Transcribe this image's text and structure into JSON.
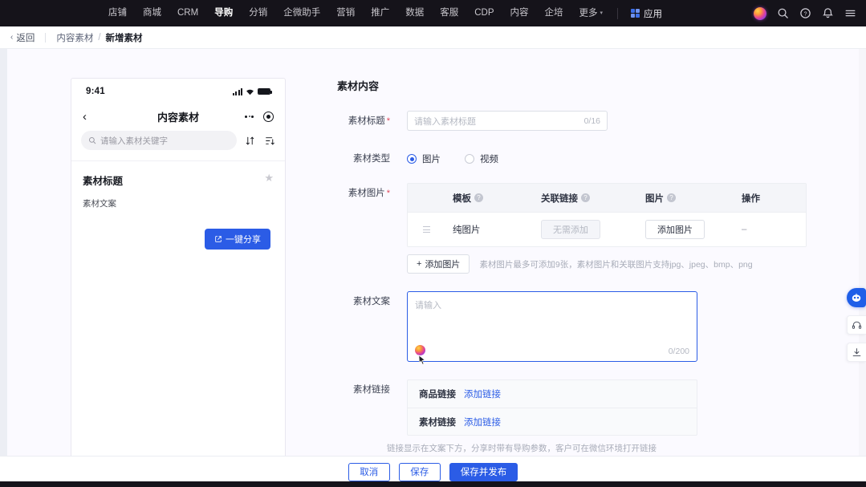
{
  "topnav": {
    "items": [
      {
        "label": "店铺",
        "active": false
      },
      {
        "label": "商城",
        "active": false
      },
      {
        "label": "CRM",
        "active": false
      },
      {
        "label": "导购",
        "active": true
      },
      {
        "label": "分销",
        "active": false
      },
      {
        "label": "企微助手",
        "active": false
      },
      {
        "label": "营销",
        "active": false
      },
      {
        "label": "推广",
        "active": false
      },
      {
        "label": "数据",
        "active": false
      },
      {
        "label": "客服",
        "active": false
      },
      {
        "label": "CDP",
        "active": false
      },
      {
        "label": "内容",
        "active": false
      },
      {
        "label": "企培",
        "active": false
      },
      {
        "label": "更多",
        "active": false,
        "caret": "▾"
      }
    ],
    "app_label": "应用",
    "icons": [
      "ai-orb-icon",
      "search-icon",
      "help-icon",
      "bell-icon",
      "menu-icon"
    ]
  },
  "breadcrumb": {
    "back_label": "返回",
    "back_chevron": "‹",
    "parent": "内容素材",
    "separator": "/",
    "current": "新增素材"
  },
  "phone_preview": {
    "status_time": "9:41",
    "nav_back": "‹",
    "nav_title": "内容素材",
    "search_placeholder": "请输入素材关键字",
    "card_title": "素材标题",
    "card_desc": "素材文案",
    "share_button": "一键分享",
    "share_icon": "share-icon",
    "star_icon": "★"
  },
  "form": {
    "section_title": "素材内容",
    "title_field": {
      "label": "素材标题",
      "required": "*",
      "placeholder": "请输入素材标题",
      "counter": "0/16",
      "value": ""
    },
    "type_field": {
      "label": "素材类型",
      "options": [
        {
          "label": "图片",
          "selected": true
        },
        {
          "label": "视频",
          "selected": false
        }
      ]
    },
    "images_field": {
      "label": "素材图片",
      "required": "*",
      "columns": [
        "",
        "模板",
        "关联链接",
        "图片",
        "操作"
      ],
      "rows": [
        {
          "drag": "drag-handle",
          "template": "纯图片",
          "link_button": "无需添加",
          "image_button": "添加图片",
          "action": "–"
        }
      ],
      "add_button": "添加图片",
      "add_icon": "+",
      "hint": "素材图片最多可添加9张，素材图片和关联图片支持jpg、jpeg、bmp、png"
    },
    "copy_field": {
      "label": "素材文案",
      "placeholder": "请输入",
      "counter": "0/200",
      "value": "",
      "ai_icon": "ai-sparkle-icon"
    },
    "links_field": {
      "label": "素材链接",
      "rows": [
        {
          "label": "商品链接",
          "action": "添加链接"
        },
        {
          "label": "素材链接",
          "action": "添加链接"
        }
      ],
      "hint": "链接显示在文案下方，分享时带有导购参数，客户可在微信环境打开链接"
    }
  },
  "footer": {
    "cancel": "取消",
    "save": "保存",
    "publish": "保存并发布"
  },
  "float_widgets": [
    {
      "name": "robot-assistant-icon"
    },
    {
      "name": "headset-support-icon"
    },
    {
      "name": "download-icon"
    }
  ],
  "colors": {
    "primary": "#2b5ce6",
    "nav_bg": "#15131a",
    "page_bg": "#fbfaff",
    "required": "#e0475b"
  }
}
